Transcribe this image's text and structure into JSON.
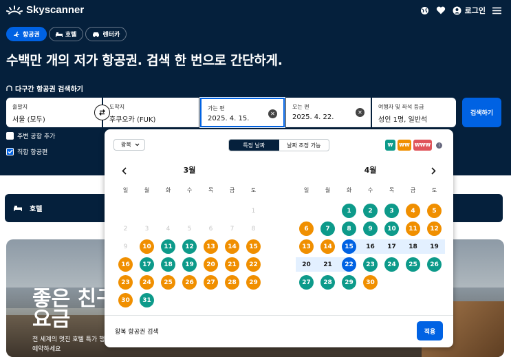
{
  "header": {
    "brand": "Skyscanner",
    "login_label": "로그인",
    "icons": [
      "globe-icon",
      "heart-icon",
      "account-icon",
      "menu-icon"
    ]
  },
  "tabs": [
    {
      "label": "항공권",
      "icon": "plane-icon",
      "active": true
    },
    {
      "label": "호텔",
      "icon": "bed-icon",
      "active": false
    },
    {
      "label": "렌터카",
      "icon": "car-icon",
      "active": false
    }
  ],
  "headline": "수백만 개의 저가 항공권. 검색 한 번으로 간단하게.",
  "multi_city_link": "다구간 항공권 검색하기",
  "search": {
    "from_label": "출발지",
    "from_value": "서울 (모두)",
    "to_label": "도착지",
    "to_value": "후쿠오카 (FUK)",
    "depart_label": "가는 편",
    "depart_value": "2025. 4. 15.",
    "return_label": "오는 편",
    "return_value": "2025. 4. 22.",
    "travellers_label": "여행자 및 좌석 등급",
    "travellers_value": "성인 1명, 일반석",
    "button": "검색하기"
  },
  "options": {
    "nearby_airports": "주변 공항 추가",
    "nearby_checked": false,
    "direct_flights": "직항 항공편",
    "direct_checked": true
  },
  "hotel_card": {
    "label": "호텔"
  },
  "promo": {
    "title": "좋은 친구 요금",
    "subtitle": "전 세계의 멋진 호텔 특가 행을 예약하세요"
  },
  "calendar": {
    "trip_type": "왕복",
    "mode_tabs": [
      "특정 날짜",
      "날짜 조정 가능"
    ],
    "active_mode": 0,
    "legend": [
      {
        "label": "₩",
        "color": "#0d9a8a"
      },
      {
        "label": "₩₩",
        "color": "#f08f00"
      },
      {
        "label": "₩₩₩",
        "color": "#e0555b"
      }
    ],
    "weekdays": [
      "일",
      "월",
      "화",
      "수",
      "목",
      "금",
      "토"
    ],
    "months": [
      {
        "title": "3월",
        "first_weekday": 6,
        "days": 31,
        "past_until": 9,
        "colors": {
          "10": "orange",
          "11": "green",
          "12": "green",
          "13": "orange",
          "14": "orange",
          "15": "orange",
          "16": "orange",
          "17": "green",
          "18": "green",
          "19": "green",
          "20": "orange",
          "21": "orange",
          "22": "orange",
          "23": "orange",
          "24": "orange",
          "25": "orange",
          "26": "orange",
          "27": "orange",
          "28": "orange",
          "29": "orange",
          "30": "orange",
          "31": "green"
        }
      },
      {
        "title": "4월",
        "first_weekday": 2,
        "days": 30,
        "past_until": 0,
        "colors": {
          "1": "green",
          "2": "green",
          "3": "green",
          "4": "orange",
          "5": "orange",
          "6": "orange",
          "7": "green",
          "8": "green",
          "9": "green",
          "10": "green",
          "11": "orange",
          "12": "orange",
          "13": "orange",
          "14": "orange",
          "15": "blue",
          "22": "blue",
          "23": "green",
          "24": "green",
          "25": "green",
          "26": "green",
          "27": "green",
          "28": "green",
          "29": "green",
          "30": "orange"
        },
        "range_start": 15,
        "range_end": 22
      }
    ],
    "footer_text": "왕복 항공권 검색",
    "apply_label": "적용"
  }
}
